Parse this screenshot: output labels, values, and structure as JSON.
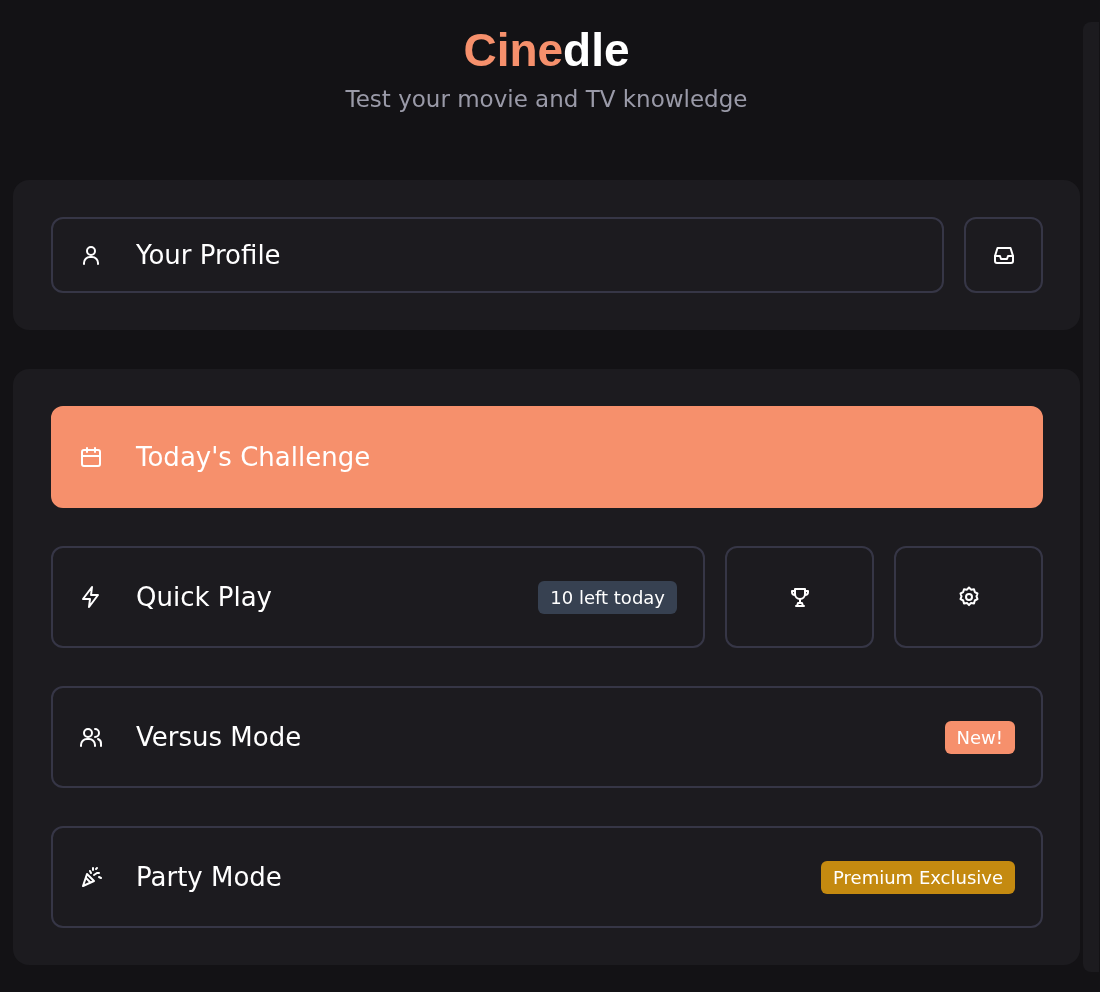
{
  "header": {
    "logo": {
      "accent": "Cine",
      "rest": "dle"
    },
    "tagline": "Test your movie and TV knowledge"
  },
  "profile_card": {
    "profile_button": {
      "label": "Your Profile"
    }
  },
  "modes": [
    {
      "kind": "primary",
      "label": "Today's Challenge"
    },
    {
      "kind": "split",
      "label": "Quick Play",
      "badge": {
        "text": "10 left today",
        "color": "#374151"
      },
      "side_buttons": [
        {
          "kind": "leaderboard"
        },
        {
          "kind": "settings"
        }
      ]
    },
    {
      "kind": "row",
      "label": "Versus Mode",
      "badge": {
        "text": "New!",
        "color": "#f6906c"
      }
    },
    {
      "kind": "row",
      "label": "Party Mode",
      "badge": {
        "text": "Premium Exclusive",
        "color": "#c48a10"
      }
    }
  ]
}
